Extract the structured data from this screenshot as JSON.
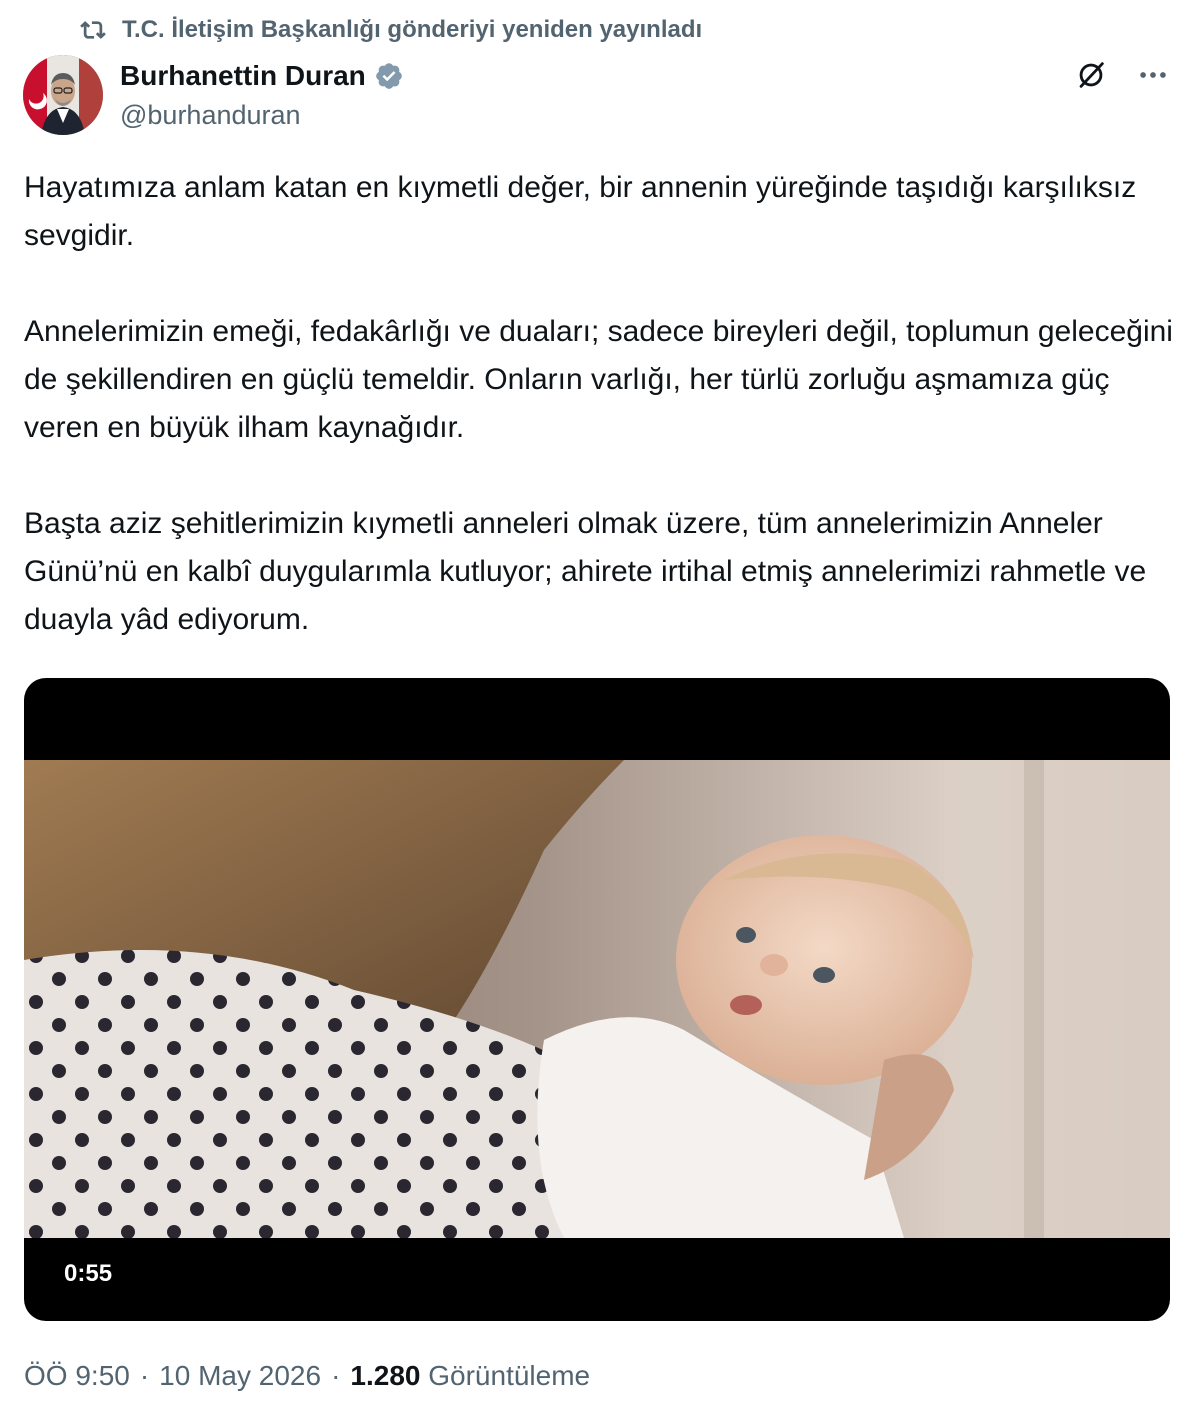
{
  "repost": {
    "icon": "repost-icon",
    "text": "T.C. İletişim Başkanlığı gönderiyi yeniden yayınladı"
  },
  "author": {
    "name": "Burhanettin Duran",
    "handle": "@burhanduran",
    "verified": true,
    "badge_color": "#829aab"
  },
  "actions": {
    "grok_icon": "grok-icon",
    "more_icon": "more-icon"
  },
  "tweet": {
    "paragraphs": [
      "Hayatımıza anlam katan en kıymetli değer, bir annenin yüreğinde taşıdığı karşılıksız sevgidir.",
      "Annelerimizin emeği, fedakârlığı ve duaları; sadece bireyleri değil, toplumun geleceğini de şekillendiren en güçlü temeldir. Onların varlığı, her türlü zorluğu aşmamıza güç veren en büyük ilham kaynağıdır.",
      "Başta aziz şehitlerimizin kıymetli anneleri olmak üzere, tüm annelerimizin Anneler Günü’nü en kalbî duygularımla kutluyor; ahirete irtihal etmiş annelerimizi rahmetle ve duayla yâd ediyorum."
    ]
  },
  "video": {
    "duration": "0:55"
  },
  "meta": {
    "time": "ÖÖ 9:50",
    "separator": "·",
    "date": "10 May 2026",
    "views_count": "1.280",
    "views_label": "Görüntüleme"
  }
}
